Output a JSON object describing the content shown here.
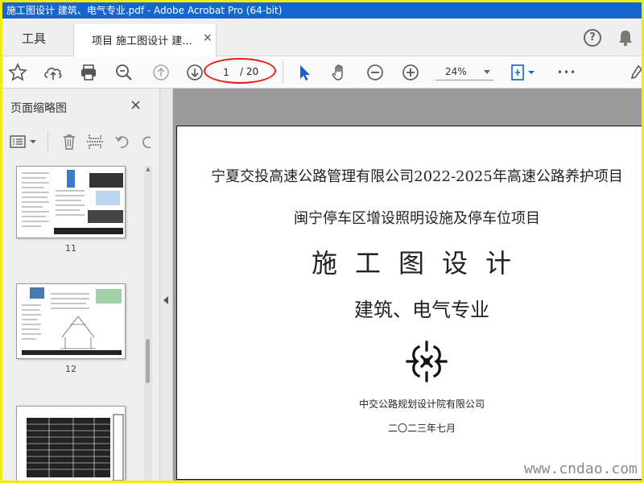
{
  "window": {
    "title": "施工图设计 建筑、电气专业.pdf - Adobe Acrobat Pro (64-bit)"
  },
  "tabs": {
    "tools_label": "工具",
    "doc_label": "项目 施工图设计 建...",
    "close_symbol": "×",
    "help_symbol": "?"
  },
  "toolbar": {
    "current_page": "1",
    "total_pages": "/ 20",
    "zoom": "24%",
    "more_symbol": "•••"
  },
  "sidebar": {
    "title": "页面缩略图",
    "close_symbol": "×",
    "thumbnails": [
      {
        "page": "11"
      },
      {
        "page": "12"
      }
    ]
  },
  "document": {
    "line1": "宁夏交投高速公路管理有限公司2022-2025年高速公路养护项目",
    "line2": "闽宁停车区增设照明设施及停车位项目",
    "line3": "施工图设计",
    "line4": "建筑、电气专业",
    "company": "中交公路规划设计院有限公司",
    "date": "二〇二三年七月"
  },
  "watermark": "www.cndao.com",
  "colors": {
    "titlebar": "#1766cf",
    "frame_border": "#f0ec14",
    "highlight_ellipse": "#e3201b",
    "cursor_accent": "#1a5fd0"
  }
}
